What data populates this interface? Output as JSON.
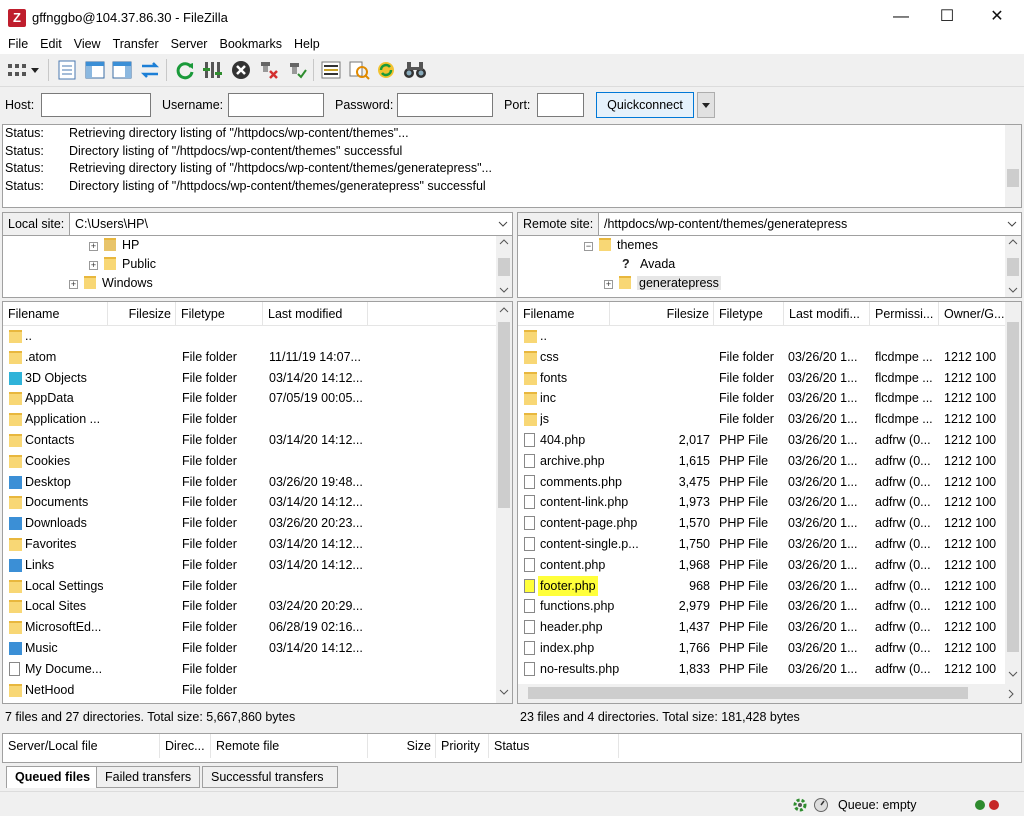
{
  "window": {
    "app_icon": "Z",
    "title": "gffnggbo@104.37.86.30 - FileZilla",
    "minimize": "—",
    "maximize": "☐",
    "close": "✕"
  },
  "menu": [
    "File",
    "Edit",
    "View",
    "Transfer",
    "Server",
    "Bookmarks",
    "Help"
  ],
  "toolbar_icons": [
    "site-manager-icon",
    "dropdown-arrow-icon",
    "toggle-log-icon",
    "toggle-local-tree-icon",
    "toggle-remote-tree-icon",
    "toggle-queue-icon",
    "refresh-icon",
    "filter-icon",
    "cancel-icon",
    "disconnect-icon",
    "reconnect-icon",
    "directory-compare-icon",
    "sync-browse-icon",
    "find-icon",
    "binoculars-icon"
  ],
  "quickconnect": {
    "host_label": "Host:",
    "host_value": "",
    "user_label": "Username:",
    "user_value": "",
    "pass_label": "Password:",
    "pass_value": "",
    "port_label": "Port:",
    "port_value": "",
    "button": "Quickconnect"
  },
  "log": [
    {
      "k": "Status:",
      "v": "Retrieving directory listing of \"/httpdocs/wp-content/themes\"..."
    },
    {
      "k": "Status:",
      "v": "Directory listing of \"/httpdocs/wp-content/themes\" successful"
    },
    {
      "k": "Status:",
      "v": "Retrieving directory listing of \"/httpdocs/wp-content/themes/generatepress\"..."
    },
    {
      "k": "Status:",
      "v": "Directory listing of \"/httpdocs/wp-content/themes/generatepress\" successful"
    }
  ],
  "local": {
    "site_label": "Local site:",
    "site_path": "C:\\Users\\HP\\",
    "tree": [
      "HP",
      "Public",
      "Windows"
    ],
    "columns": [
      "Filename",
      "Filesize",
      "Filetype",
      "Last modified"
    ],
    "rows": [
      {
        "name": "..",
        "size": "",
        "type": "",
        "mod": "",
        "icon": "folder"
      },
      {
        "name": ".atom",
        "size": "",
        "type": "File folder",
        "mod": "11/11/19 14:07...",
        "icon": "folder"
      },
      {
        "name": "3D Objects",
        "size": "",
        "type": "File folder",
        "mod": "03/14/20 14:12...",
        "icon": "cube"
      },
      {
        "name": "AppData",
        "size": "",
        "type": "File folder",
        "mod": "07/05/19 00:05...",
        "icon": "folder"
      },
      {
        "name": "Application ...",
        "size": "",
        "type": "File folder",
        "mod": "",
        "icon": "folder"
      },
      {
        "name": "Contacts",
        "size": "",
        "type": "File folder",
        "mod": "03/14/20 14:12...",
        "icon": "folder"
      },
      {
        "name": "Cookies",
        "size": "",
        "type": "File folder",
        "mod": "",
        "icon": "folder"
      },
      {
        "name": "Desktop",
        "size": "",
        "type": "File folder",
        "mod": "03/26/20 19:48...",
        "icon": "blue"
      },
      {
        "name": "Documents",
        "size": "",
        "type": "File folder",
        "mod": "03/14/20 14:12...",
        "icon": "folder"
      },
      {
        "name": "Downloads",
        "size": "",
        "type": "File folder",
        "mod": "03/26/20 20:23...",
        "icon": "blue"
      },
      {
        "name": "Favorites",
        "size": "",
        "type": "File folder",
        "mod": "03/14/20 14:12...",
        "icon": "folder"
      },
      {
        "name": "Links",
        "size": "",
        "type": "File folder",
        "mod": "03/14/20 14:12...",
        "icon": "blue"
      },
      {
        "name": "Local Settings",
        "size": "",
        "type": "File folder",
        "mod": "",
        "icon": "folder"
      },
      {
        "name": "Local Sites",
        "size": "",
        "type": "File folder",
        "mod": "03/24/20 20:29...",
        "icon": "folder"
      },
      {
        "name": "MicrosoftEd...",
        "size": "",
        "type": "File folder",
        "mod": "06/28/19 02:16...",
        "icon": "folder"
      },
      {
        "name": "Music",
        "size": "",
        "type": "File folder",
        "mod": "03/14/20 14:12...",
        "icon": "blue"
      },
      {
        "name": "My Docume...",
        "size": "",
        "type": "File folder",
        "mod": "",
        "icon": "file"
      },
      {
        "name": "NetHood",
        "size": "",
        "type": "File folder",
        "mod": "",
        "icon": "folder"
      }
    ],
    "status": "7 files and 27 directories. Total size: 5,667,860 bytes"
  },
  "remote": {
    "site_label": "Remote site:",
    "site_path": "/httpdocs/wp-content/themes/generatepress",
    "tree": [
      "themes",
      "Avada",
      "generatepress"
    ],
    "columns": [
      "Filename",
      "Filesize",
      "Filetype",
      "Last modifi...",
      "Permissi...",
      "Owner/G..."
    ],
    "rows": [
      {
        "name": "..",
        "size": "",
        "type": "",
        "mod": "",
        "perm": "",
        "own": "",
        "icon": "folder"
      },
      {
        "name": "css",
        "size": "",
        "type": "File folder",
        "mod": "03/26/20 1...",
        "perm": "flcdmpe ...",
        "own": "1212 100",
        "icon": "folder"
      },
      {
        "name": "fonts",
        "size": "",
        "type": "File folder",
        "mod": "03/26/20 1...",
        "perm": "flcdmpe ...",
        "own": "1212 100",
        "icon": "folder"
      },
      {
        "name": "inc",
        "size": "",
        "type": "File folder",
        "mod": "03/26/20 1...",
        "perm": "flcdmpe ...",
        "own": "1212 100",
        "icon": "folder"
      },
      {
        "name": "js",
        "size": "",
        "type": "File folder",
        "mod": "03/26/20 1...",
        "perm": "flcdmpe ...",
        "own": "1212 100",
        "icon": "folder"
      },
      {
        "name": "404.php",
        "size": "2,017",
        "type": "PHP File",
        "mod": "03/26/20 1...",
        "perm": "adfrw (0...",
        "own": "1212 100",
        "icon": "file"
      },
      {
        "name": "archive.php",
        "size": "1,615",
        "type": "PHP File",
        "mod": "03/26/20 1...",
        "perm": "adfrw (0...",
        "own": "1212 100",
        "icon": "file"
      },
      {
        "name": "comments.php",
        "size": "3,475",
        "type": "PHP File",
        "mod": "03/26/20 1...",
        "perm": "adfrw (0...",
        "own": "1212 100",
        "icon": "file"
      },
      {
        "name": "content-link.php",
        "size": "1,973",
        "type": "PHP File",
        "mod": "03/26/20 1...",
        "perm": "adfrw (0...",
        "own": "1212 100",
        "icon": "file"
      },
      {
        "name": "content-page.php",
        "size": "1,570",
        "type": "PHP File",
        "mod": "03/26/20 1...",
        "perm": "adfrw (0...",
        "own": "1212 100",
        "icon": "file"
      },
      {
        "name": "content-single.p...",
        "size": "1,750",
        "type": "PHP File",
        "mod": "03/26/20 1...",
        "perm": "adfrw (0...",
        "own": "1212 100",
        "icon": "file"
      },
      {
        "name": "content.php",
        "size": "1,968",
        "type": "PHP File",
        "mod": "03/26/20 1...",
        "perm": "adfrw (0...",
        "own": "1212 100",
        "icon": "file"
      },
      {
        "name": "footer.php",
        "size": "968",
        "type": "PHP File",
        "mod": "03/26/20 1...",
        "perm": "adfrw (0...",
        "own": "1212 100",
        "icon": "file",
        "highlight": true
      },
      {
        "name": "functions.php",
        "size": "2,979",
        "type": "PHP File",
        "mod": "03/26/20 1...",
        "perm": "adfrw (0...",
        "own": "1212 100",
        "icon": "file"
      },
      {
        "name": "header.php",
        "size": "1,437",
        "type": "PHP File",
        "mod": "03/26/20 1...",
        "perm": "adfrw (0...",
        "own": "1212 100",
        "icon": "file"
      },
      {
        "name": "index.php",
        "size": "1,766",
        "type": "PHP File",
        "mod": "03/26/20 1...",
        "perm": "adfrw (0...",
        "own": "1212 100",
        "icon": "file"
      },
      {
        "name": "no-results.php",
        "size": "1,833",
        "type": "PHP File",
        "mod": "03/26/20 1...",
        "perm": "adfrw (0...",
        "own": "1212 100",
        "icon": "file"
      }
    ],
    "status": "23 files and 4 directories. Total size: 181,428 bytes"
  },
  "queue": {
    "columns": [
      "Server/Local file",
      "Direc...",
      "Remote file",
      "Size",
      "Priority",
      "Status"
    ],
    "tabs": [
      "Queued files",
      "Failed transfers",
      "Successful transfers"
    ],
    "status": "Queue: empty"
  },
  "colors": {
    "highlight": "#ffff3a",
    "accent": "#0078d7",
    "led_green": "#2e8b2e",
    "led_red": "#c62828"
  }
}
